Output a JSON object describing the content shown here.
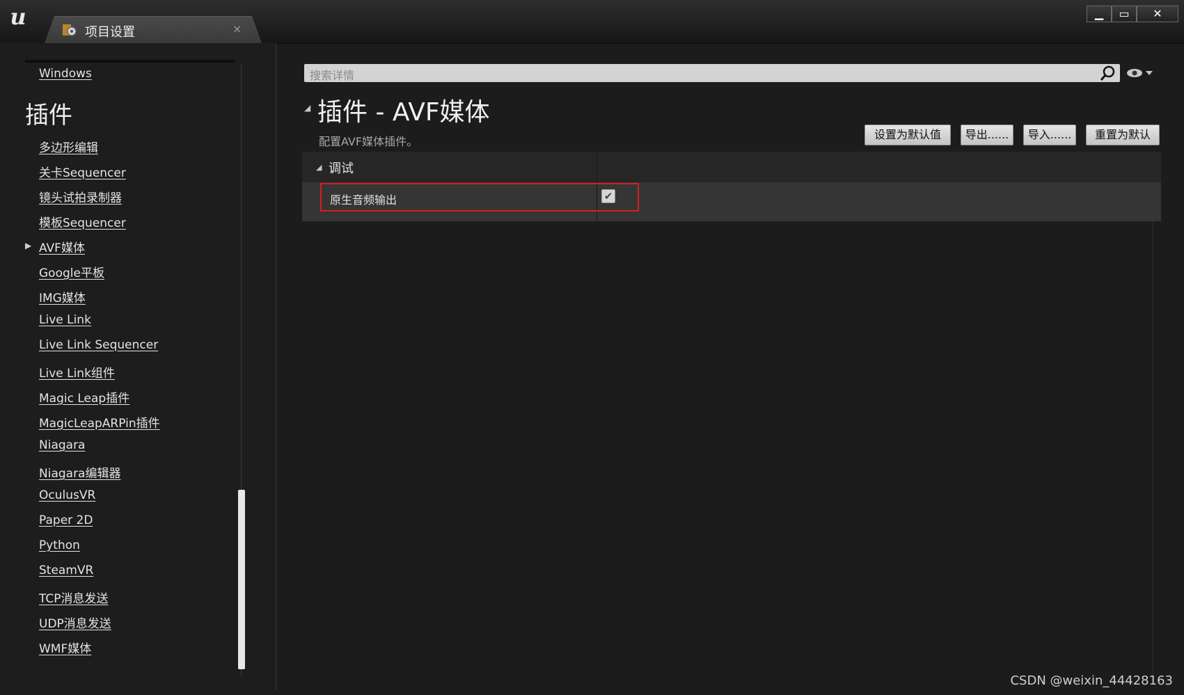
{
  "window": {
    "tab_title": "项目设置",
    "tab_close": "×",
    "controls": {
      "minimize": "▁",
      "maximize": "▭",
      "close": "✕"
    },
    "logo": "u"
  },
  "sidebar": {
    "top_item": "Windows",
    "heading": "插件",
    "items": [
      "多边形编辑",
      "关卡Sequencer",
      "镜头试拍录制器",
      "模板Sequencer",
      "AVF媒体",
      "Google平板",
      "IMG媒体",
      "Live Link",
      "Live Link Sequencer",
      "Live Link组件",
      "Magic Leap插件",
      "MagicLeapARPin插件",
      "Niagara",
      "Niagara编辑器",
      "OculusVR",
      "Paper 2D",
      "Python",
      "SteamVR",
      "TCP消息发送",
      "UDP消息发送",
      "WMF媒体"
    ],
    "expanded_item": "AVF媒体"
  },
  "search": {
    "placeholder": "搜索详情"
  },
  "section": {
    "title": "插件 - AVF媒体",
    "subtitle": "配置AVF媒体插件。"
  },
  "actions": {
    "set_default": "设置为默认值",
    "export": "导出......",
    "import": "导入......",
    "reset_default": "重置为默认"
  },
  "category": {
    "label": "调试",
    "properties": [
      {
        "label": "原生音频输出",
        "checked": true,
        "check_glyph": "✔"
      }
    ]
  },
  "watermark": "CSDN @weixin_44428163",
  "colors": {
    "highlight": "#d61f1f",
    "background": "#1c1c1c"
  }
}
